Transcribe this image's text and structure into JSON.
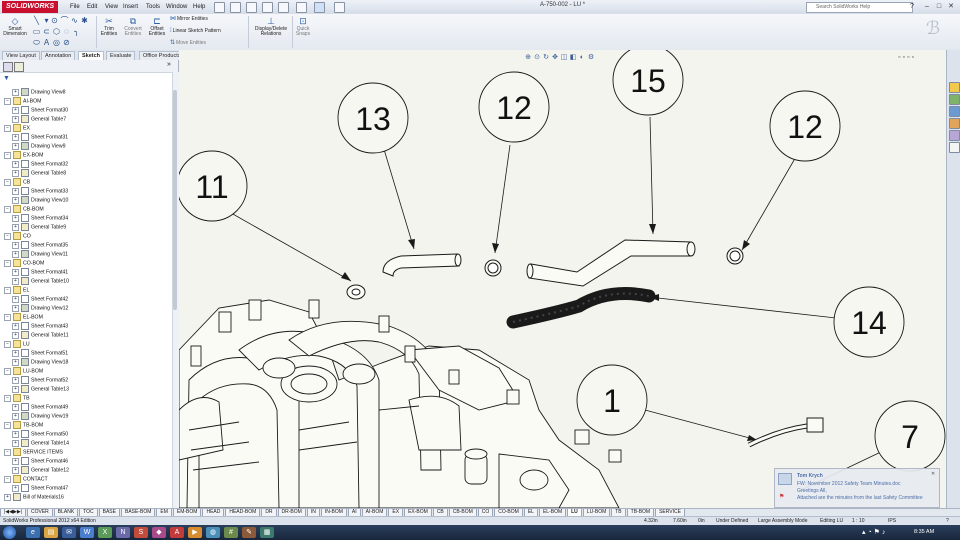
{
  "app": {
    "logo": "SOLIDWORKS",
    "menu": [
      "File",
      "Edit",
      "View",
      "Insert",
      "Tools",
      "Window",
      "Help"
    ],
    "doc_title": "A-750-002 - LU *",
    "search_placeholder": "Search SolidWorks Help"
  },
  "ribbon": {
    "smart_dimension": "Smart Dimension",
    "trim": "Trim Entities",
    "convert": "Convert Entities",
    "offset": "Offset Entities",
    "mirror": "Mirror Entities",
    "linear_pattern": "Linear Sketch Pattern",
    "move": "Move Entities",
    "display_delete": "Display/Delete Relations",
    "quick_snaps": "Quick Snaps"
  },
  "tabs": [
    "View Layout",
    "Annotation",
    "Sketch",
    "Evaluate",
    "Office Products"
  ],
  "active_tab": "Sketch",
  "tree": [
    {
      "level": 2,
      "type": "view",
      "label": "Drawing View8"
    },
    {
      "level": 1,
      "type": "folder",
      "label": "AI-BOM"
    },
    {
      "level": 2,
      "type": "sheet",
      "label": "Sheet Format30"
    },
    {
      "level": 2,
      "type": "table",
      "label": "General Table7"
    },
    {
      "level": 1,
      "type": "folder",
      "label": "EX"
    },
    {
      "level": 2,
      "type": "sheet",
      "label": "Sheet Format31"
    },
    {
      "level": 2,
      "type": "view",
      "label": "Drawing View9"
    },
    {
      "level": 1,
      "type": "folder",
      "label": "EX-BOM"
    },
    {
      "level": 2,
      "type": "sheet",
      "label": "Sheet Format32"
    },
    {
      "level": 2,
      "type": "table",
      "label": "General Table8"
    },
    {
      "level": 1,
      "type": "folder",
      "label": "CB"
    },
    {
      "level": 2,
      "type": "sheet",
      "label": "Sheet Format33"
    },
    {
      "level": 2,
      "type": "view",
      "label": "Drawing View10"
    },
    {
      "level": 1,
      "type": "folder",
      "label": "CB-BOM"
    },
    {
      "level": 2,
      "type": "sheet",
      "label": "Sheet Format34"
    },
    {
      "level": 2,
      "type": "table",
      "label": "General Table9"
    },
    {
      "level": 1,
      "type": "folder",
      "label": "CO"
    },
    {
      "level": 2,
      "type": "sheet",
      "label": "Sheet Format35"
    },
    {
      "level": 2,
      "type": "view",
      "label": "Drawing View11"
    },
    {
      "level": 1,
      "type": "folder",
      "label": "CO-BOM"
    },
    {
      "level": 2,
      "type": "sheet",
      "label": "Sheet Format41"
    },
    {
      "level": 2,
      "type": "table",
      "label": "General Table10"
    },
    {
      "level": 1,
      "type": "folder",
      "label": "EL"
    },
    {
      "level": 2,
      "type": "sheet",
      "label": "Sheet Format42"
    },
    {
      "level": 2,
      "type": "view",
      "label": "Drawing View12"
    },
    {
      "level": 1,
      "type": "folder",
      "label": "EL-BOM"
    },
    {
      "level": 2,
      "type": "sheet",
      "label": "Sheet Format43"
    },
    {
      "level": 2,
      "type": "table",
      "label": "General Table11"
    },
    {
      "level": 1,
      "type": "folder",
      "label": "LU"
    },
    {
      "level": 2,
      "type": "sheet",
      "label": "Sheet Format51"
    },
    {
      "level": 2,
      "type": "view",
      "label": "Drawing View18"
    },
    {
      "level": 1,
      "type": "folder",
      "label": "LU-BOM"
    },
    {
      "level": 2,
      "type": "sheet",
      "label": "Sheet Format52"
    },
    {
      "level": 2,
      "type": "table",
      "label": "General Table13"
    },
    {
      "level": 1,
      "type": "folder",
      "label": "TB"
    },
    {
      "level": 2,
      "type": "sheet",
      "label": "Sheet Format49"
    },
    {
      "level": 2,
      "type": "view",
      "label": "Drawing View19"
    },
    {
      "level": 1,
      "type": "folder",
      "label": "TB-BOM"
    },
    {
      "level": 2,
      "type": "sheet",
      "label": "Sheet Format50"
    },
    {
      "level": 2,
      "type": "table",
      "label": "General Table14"
    },
    {
      "level": 1,
      "type": "folder",
      "label": "SERVICE ITEMS"
    },
    {
      "level": 2,
      "type": "sheet",
      "label": "Sheet Format46"
    },
    {
      "level": 2,
      "type": "table",
      "label": "General Table12"
    },
    {
      "level": 1,
      "type": "folder",
      "label": "CONTACT"
    },
    {
      "level": 2,
      "type": "sheet",
      "label": "Sheet Format47"
    },
    {
      "level": 1,
      "type": "table",
      "label": "Bill of Materials16"
    }
  ],
  "balloons": [
    "11",
    "13",
    "12",
    "15",
    "12",
    "14",
    "1",
    "7"
  ],
  "sheet_tabs": [
    "COVER",
    "BLANK",
    "TOC",
    "BASE",
    "BASE-BOM",
    "EM",
    "EM-BOM",
    "HEAD",
    "HEAD-BOM",
    "DR",
    "DR-BOM",
    "IN",
    "IN-BOM",
    "AI",
    "AI-BOM",
    "EX",
    "EX-BOM",
    "CB",
    "CB-BOM",
    "CO",
    "CO-BOM",
    "EL",
    "EL-BOM",
    "LU",
    "LU-BOM",
    "TB",
    "TB-BOM",
    "SERVICE"
  ],
  "active_sheet": "LU",
  "status": {
    "edition": "SolidWorks Professional 2012 x64 Edition",
    "x": "4.32in",
    "y": "7.60in",
    "z": "0in",
    "state": "Under Defined",
    "mode": "Large Assembly Mode",
    "editing": "Editing LU",
    "scale": "1 : 10",
    "units": "IPS"
  },
  "notification": {
    "from": "Tom Krych",
    "subject": "FW: November 2012 Safety Team Minutes.doc",
    "line2": "Greetings All,",
    "line3": "Attached are the minutes from the last Safety Committee"
  },
  "clock": "8:35 AM"
}
